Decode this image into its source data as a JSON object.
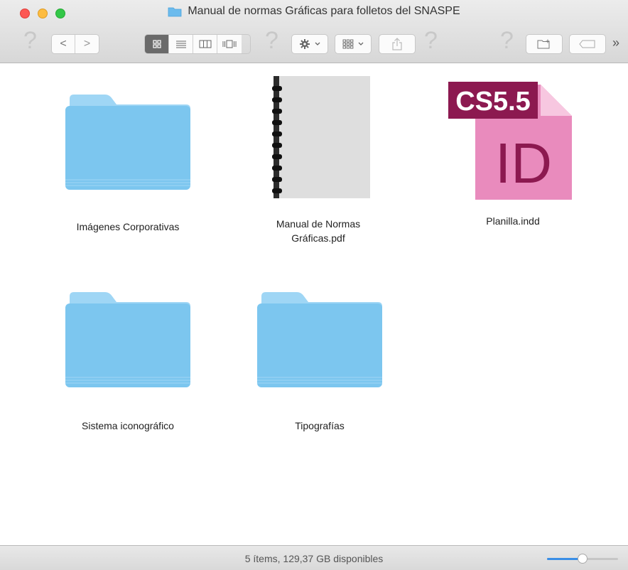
{
  "window": {
    "title": "Manual de normas Gráficas para folletos del SNASPE"
  },
  "toolbar": {
    "help_glyph": "?",
    "back_label": "<",
    "forward_label": ">",
    "overflow_label": "»",
    "views": [
      "icon-view",
      "list-view",
      "column-view",
      "coverflow-view"
    ],
    "active_view": "icon-view"
  },
  "items": [
    {
      "label": "Imágenes Corporativas",
      "kind": "folder"
    },
    {
      "label": "Manual de Normas Gráficas.pdf",
      "kind": "pdf"
    },
    {
      "label": "Planilla.indd",
      "kind": "indesign",
      "badge": "CS5.5",
      "letters": "ID"
    },
    {
      "label": "Sistema iconográfico",
      "kind": "folder"
    },
    {
      "label": "Tipografías",
      "kind": "folder"
    }
  ],
  "status": {
    "text": "5 ítems, 129,37 GB disponibles",
    "zoom_fraction": 0.5
  },
  "colors": {
    "folder": "#7cc6ef",
    "indesign": "#e98bbd",
    "indesign_badge": "#8c1950",
    "close": "#fc5753",
    "minimize": "#fdbc40",
    "zoom": "#33c748",
    "accent": "#3a8ee6"
  }
}
